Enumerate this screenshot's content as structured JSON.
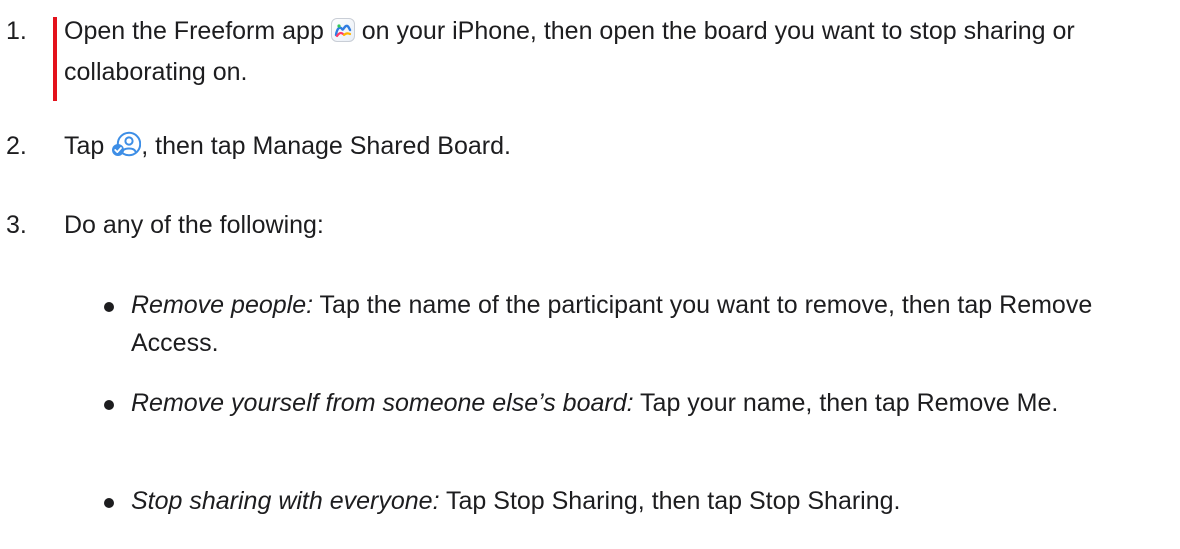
{
  "steps": [
    {
      "number": "1.",
      "before_icon": "Open the Freeform app ",
      "icon": "freeform-app-icon",
      "after_icon": " on your iPhone, then open the board you want to stop sharing or collaborating on."
    },
    {
      "number": "2.",
      "before_icon": "Tap ",
      "icon": "collaborate-people-icon",
      "after_icon": ", then tap Manage Shared Board."
    },
    {
      "number": "3.",
      "text": "Do any of the following:",
      "subitems": [
        {
          "lead": "Remove people:",
          "text": " Tap the name of the participant you want to remove, then tap Remove Access."
        },
        {
          "lead": "Remove yourself from someone else’s board:",
          "text": " Tap your name, then tap Remove Me."
        },
        {
          "lead": "Stop sharing with everyone:",
          "text": " Tap Stop Sharing, then tap Stop Sharing."
        }
      ]
    }
  ],
  "colors": {
    "text": "#1d1d1f",
    "marker": "#e3111b",
    "people_icon": "#3d8ee6"
  }
}
